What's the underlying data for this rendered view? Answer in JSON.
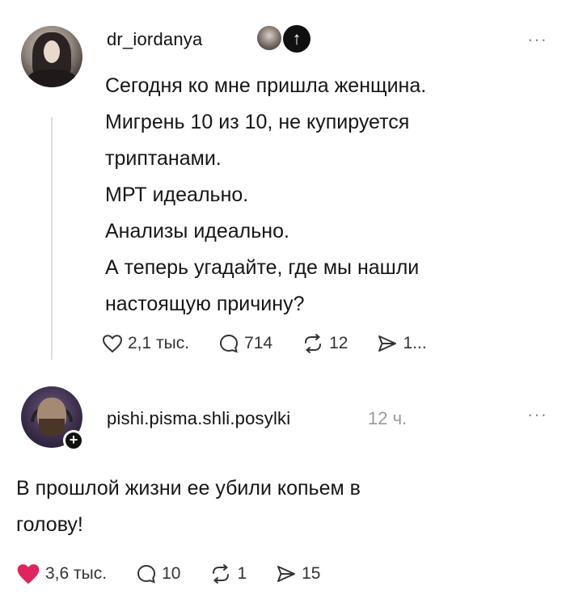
{
  "post": {
    "username": "dr_iordanya",
    "more": "···",
    "lines": [
      "Сегодня ко мне пришла женщина.",
      "Мигрень 10 из 10, не купируется",
      "триптанами.",
      "МРТ идеально.",
      "Анализы идеально.",
      "А теперь угадайте, где мы нашли",
      "настоящую причину?"
    ],
    "likes": "2,1 тыс.",
    "comments": "714",
    "reposts": "12",
    "shares": "1..."
  },
  "reply": {
    "username": "pishi.pisma.shli.posylki",
    "time": "12 ч.",
    "more": "···",
    "lines": [
      "В прошлой жизни ее убили копьем в",
      "голову!"
    ],
    "likes": "3,6 тыс.",
    "comments": "10",
    "reposts": "1",
    "shares": "15",
    "like_color": "#e0245e"
  },
  "icons": {
    "badge_arrow": "↑",
    "follow_plus": "+"
  }
}
